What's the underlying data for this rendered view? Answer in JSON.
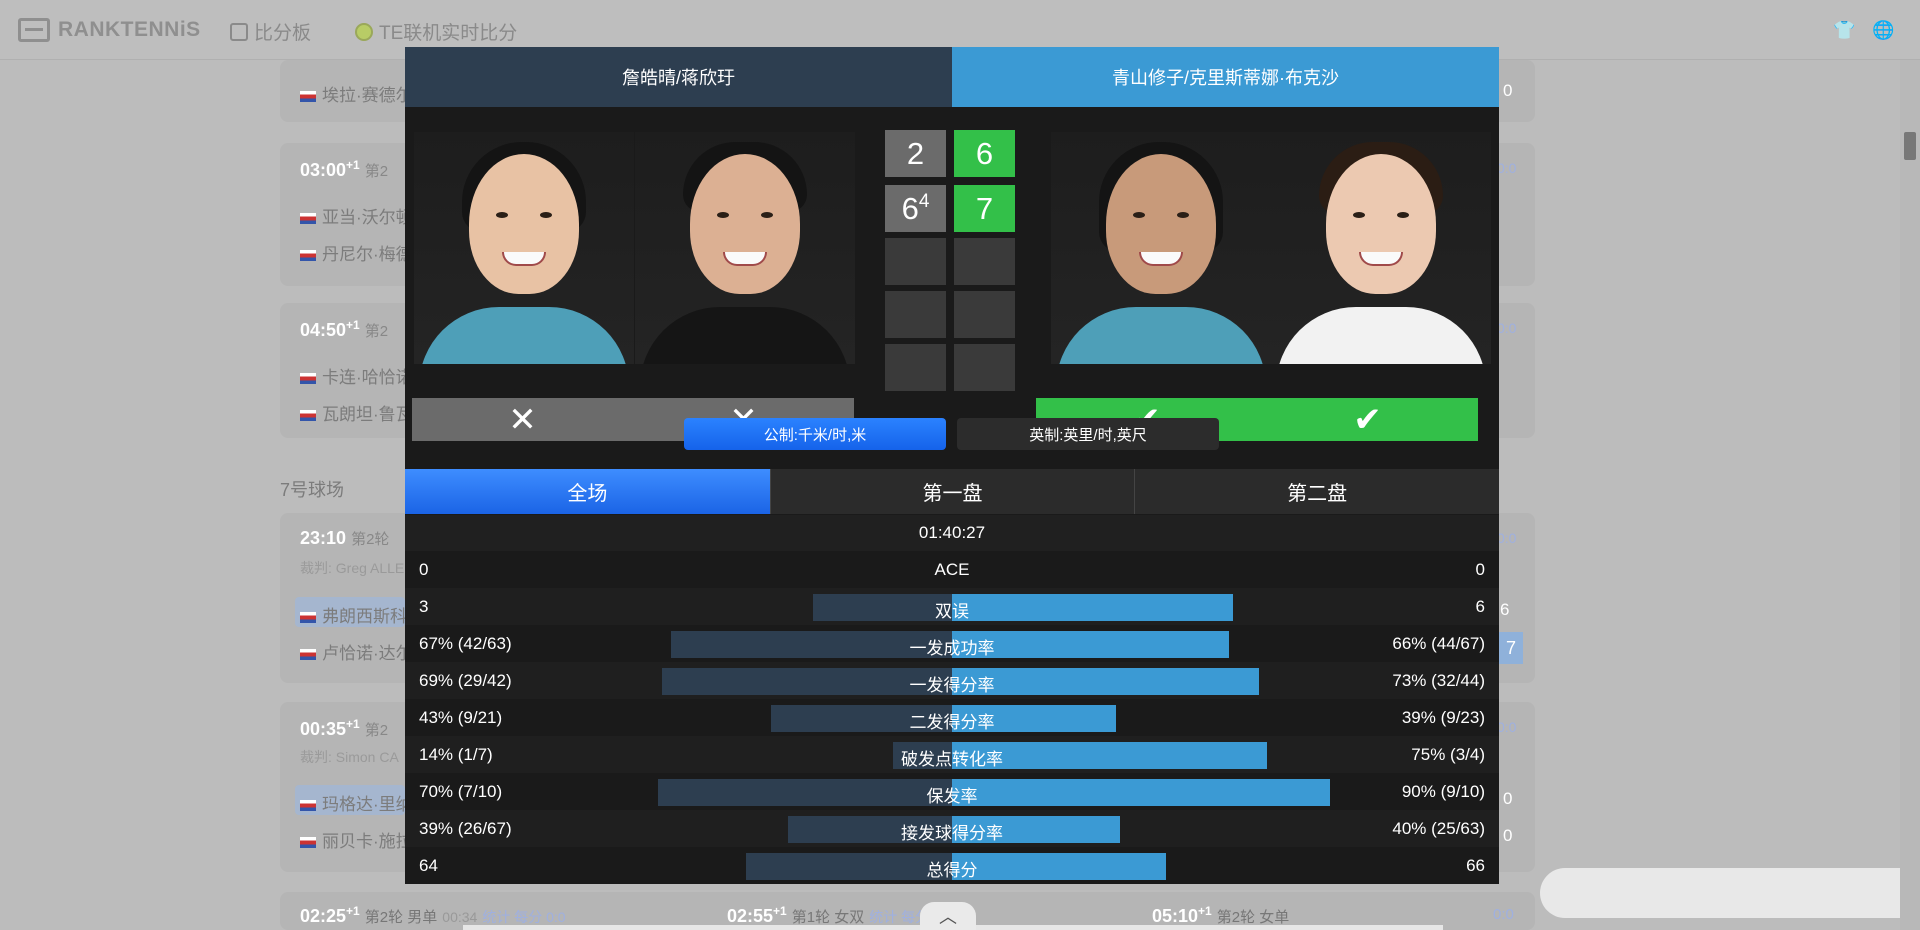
{
  "nav": {
    "logo": "RANKTENNiS",
    "scoreboard": "比分板",
    "te_live": "TE联机实时比分"
  },
  "background": {
    "court_label": "7号球场",
    "matches": [
      {
        "time": "03:00",
        "plus": "+1",
        "round": "第2",
        "p1": "亚当·沃尔顿",
        "p2": "丹尼尔·梅德"
      },
      {
        "time": "04:50",
        "plus": "+1",
        "round": "第2",
        "p1": "卡连·哈恰诺",
        "p2": "瓦朗坦·鲁瓦"
      },
      {
        "time": "23:10",
        "round": "第2轮",
        "umpire": "裁判: Greg ALLE",
        "p1": "弗朗西斯科",
        "p2": "卢恰诺·达尔"
      },
      {
        "time": "00:35",
        "plus": "+1",
        "round": "第2",
        "umpire": "裁判: Simon CA",
        "p1": "玛格达·里纳",
        "p2": "丽贝卡·施拉"
      }
    ],
    "top_player": "埃拉·赛德尔",
    "bottom": [
      {
        "time": "02:25",
        "plus": "+1",
        "round": "第2轮 男单",
        "dur": "00:34",
        "links": "统计 每分 0:0"
      },
      {
        "time": "02:55",
        "plus": "+1",
        "round": "第1轮 女双",
        "links": "统计 每分 0:0"
      },
      {
        "time": "05:10",
        "plus": "+1",
        "round": "第2轮 女单",
        "score": "0:0"
      }
    ],
    "right_scores": [
      "0",
      "0:0",
      "0:0",
      "0:0",
      "6",
      "7",
      "0:0",
      "0",
      "0",
      "0:0"
    ]
  },
  "modal": {
    "team_a": "詹皓晴/蒋欣玗",
    "team_b": "青山修子/克里斯蒂娜·布克沙",
    "sets": [
      {
        "a": "2",
        "b": "6"
      },
      {
        "a": "6",
        "a_tb": "4",
        "b": "7"
      }
    ],
    "unit_metric": "公制:千米/时,米",
    "unit_imperial": "英制:英里/时,英尺",
    "tabs": [
      "全场",
      "第一盘",
      "第二盘"
    ],
    "duration": "01:40:27",
    "stats": [
      {
        "label": "ACE",
        "a": "0",
        "b": "0",
        "a_pct": 0,
        "b_pct": 0
      },
      {
        "label": "双误",
        "a": "3",
        "b": "6",
        "a_pct": 0.33,
        "b_pct": 0.67
      },
      {
        "label": "一发成功率",
        "a": "67% (42/63)",
        "b": "66% (44/67)",
        "a_pct": 0.67,
        "b_pct": 0.66
      },
      {
        "label": "一发得分率",
        "a": "69% (29/42)",
        "b": "73% (32/44)",
        "a_pct": 0.69,
        "b_pct": 0.73
      },
      {
        "label": "二发得分率",
        "a": "43% (9/21)",
        "b": "39% (9/23)",
        "a_pct": 0.43,
        "b_pct": 0.39
      },
      {
        "label": "破发点转化率",
        "a": "14% (1/7)",
        "b": "75% (3/4)",
        "a_pct": 0.14,
        "b_pct": 0.75
      },
      {
        "label": "保发率",
        "a": "70% (7/10)",
        "b": "90% (9/10)",
        "a_pct": 0.7,
        "b_pct": 0.9
      },
      {
        "label": "接发球得分率",
        "a": "39% (26/67)",
        "b": "40% (25/63)",
        "a_pct": 0.39,
        "b_pct": 0.4
      },
      {
        "label": "总得分",
        "a": "64",
        "b": "66",
        "a_pct": 0.49,
        "b_pct": 0.51
      }
    ],
    "result_icons": {
      "team_a": "close-icon",
      "team_b": "check-icon"
    }
  }
}
